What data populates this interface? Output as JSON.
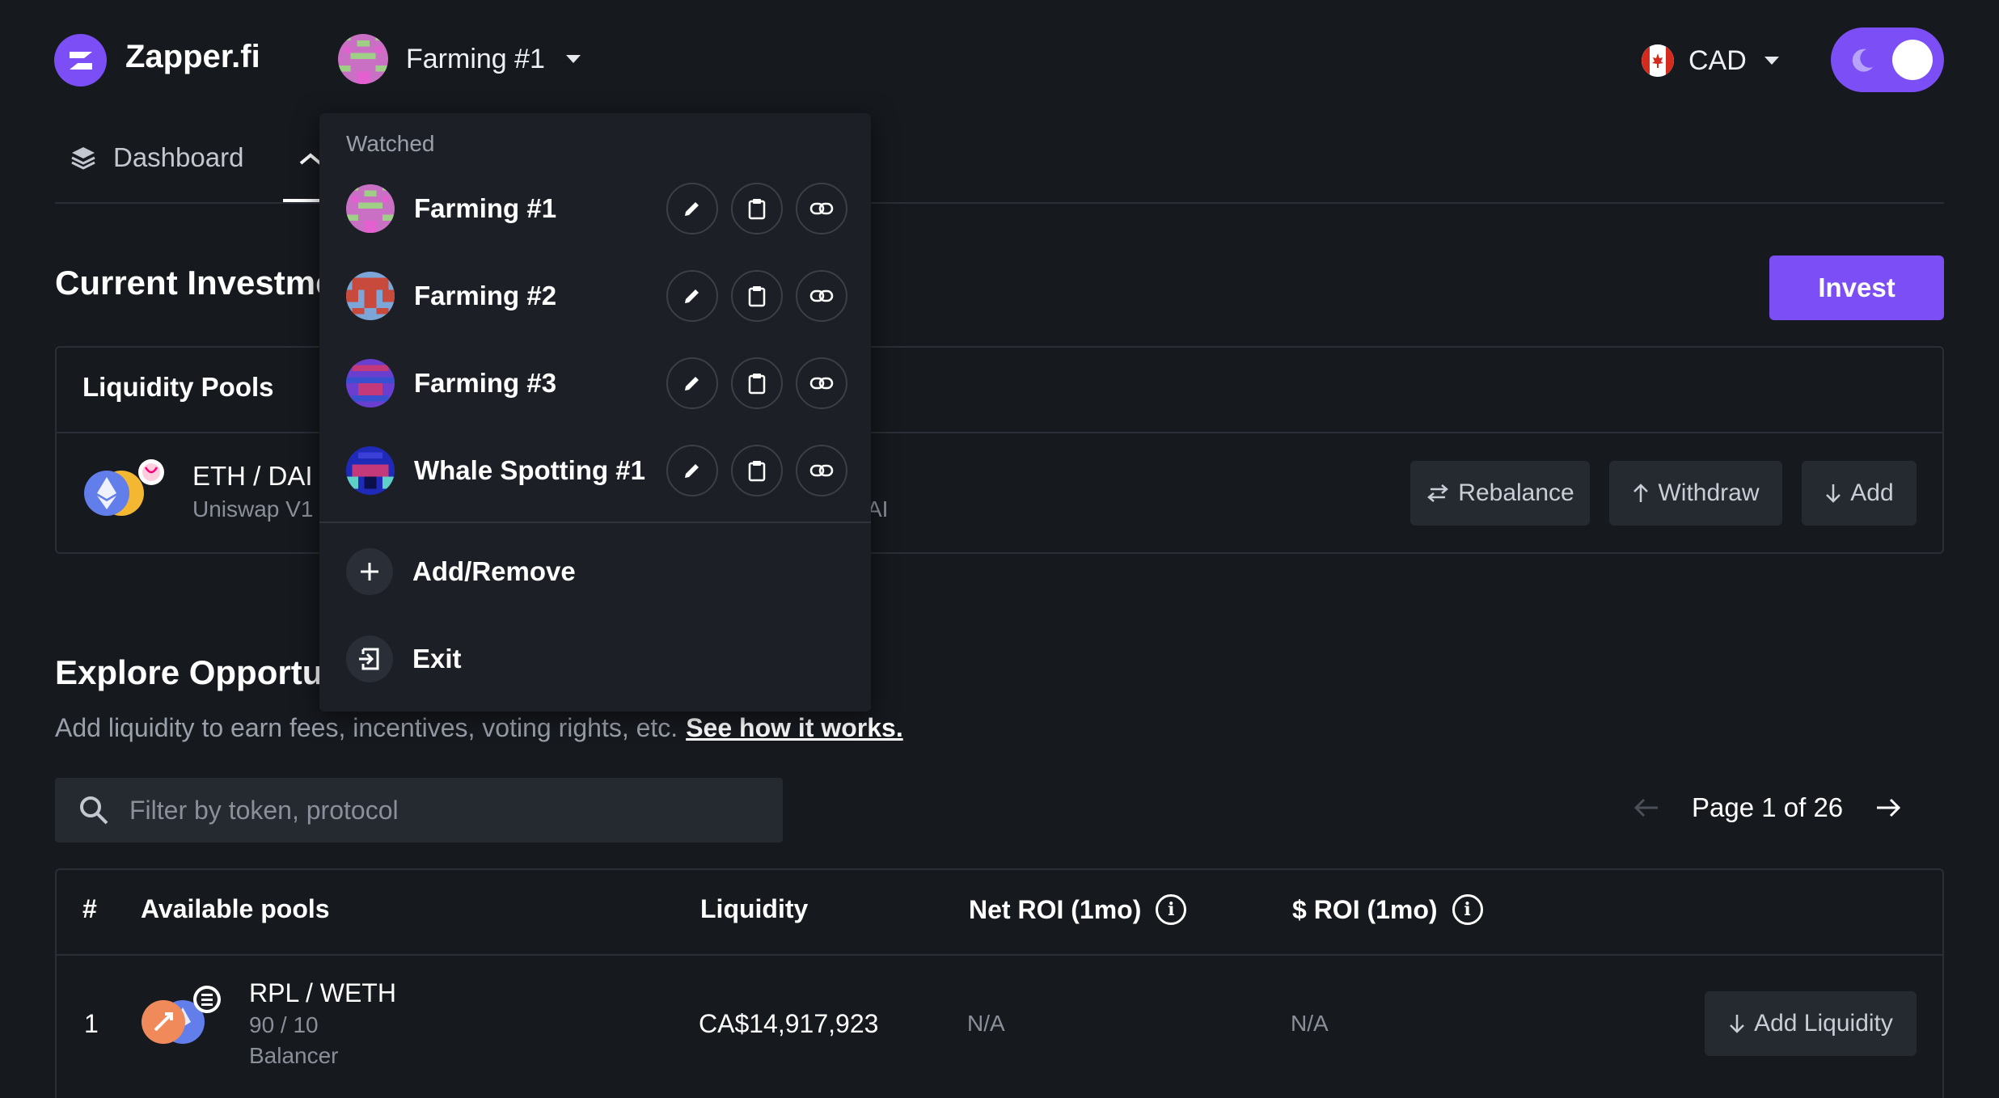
{
  "header": {
    "brand": "Zapper.fi",
    "account": "Farming #1",
    "currency": "CAD"
  },
  "tabs": [
    {
      "label": "Dashboard"
    }
  ],
  "current": {
    "title": "Current Investmen",
    "invest_label": "Invest",
    "card_title": "Liquidity Pools",
    "pair": "ETH / DAI",
    "protocol": "Uniswap V1",
    "tail": "AI",
    "actions": {
      "rebalance": "Rebalance",
      "withdraw": "Withdraw",
      "add": "Add"
    }
  },
  "explore": {
    "title": "Explore Opportur",
    "description": "Add liquidity to earn fees, incentives, voting rights, etc.",
    "link": "See how it works.",
    "search_placeholder": "Filter by token, protocol",
    "page_label": "Page 1 of 26",
    "columns": {
      "num": "#",
      "pools": "Available pools",
      "liquidity": "Liquidity",
      "net_roi": "Net ROI (1mo)",
      "usd_roi": "$ ROI (1mo)"
    },
    "rows": [
      {
        "num": "1",
        "pair": "RPL / WETH",
        "ratio": "90 / 10",
        "protocol": "Balancer",
        "liquidity": "CA$14,917,923",
        "net_roi": "N/A",
        "usd_roi": "N/A",
        "action": "Add Liquidity"
      }
    ]
  },
  "dropdown": {
    "header": "Watched",
    "items": [
      {
        "name": "Farming #1"
      },
      {
        "name": "Farming #2"
      },
      {
        "name": "Farming #3"
      },
      {
        "name": "Whale Spotting #1"
      }
    ],
    "add_remove": "Add/Remove",
    "exit": "Exit"
  },
  "colors": {
    "accent": "#7b4ff5",
    "background": "#16191e",
    "panel": "#1c2026"
  }
}
